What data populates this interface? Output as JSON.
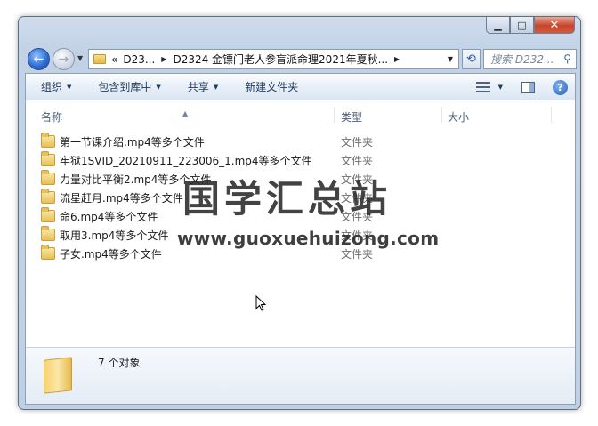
{
  "window": {
    "controls": {
      "minimize": "▁",
      "maximize": "□",
      "close": "✕"
    }
  },
  "nav": {
    "back_icon": "back-arrow-icon",
    "forward_icon": "forward-arrow-icon",
    "breadcrumb": [
      "«",
      "D23...",
      "D2324 金镖门老人参盲派命理2021年夏秋..."
    ],
    "search_placeholder": "搜索 D232..."
  },
  "toolbar": {
    "organize": "组织",
    "include_in_library": "包含到库中",
    "share": "共享",
    "new_folder": "新建文件夹"
  },
  "columns": {
    "name": "名称",
    "type": "类型",
    "size": "大小"
  },
  "files": [
    {
      "name": "第一节课介绍.mp4等多个文件",
      "type": "文件夹"
    },
    {
      "name": "牢狱1SVID_20210911_223006_1.mp4等多个文件",
      "type": "文件夹"
    },
    {
      "name": "力量对比平衡2.mp4等多个文件",
      "type": "文件夹"
    },
    {
      "name": "流星赶月.mp4等多个文件",
      "type": "文件夹"
    },
    {
      "name": "命6.mp4等多个文件",
      "type": "文件夹"
    },
    {
      "name": "取用3.mp4等多个文件",
      "type": "文件夹"
    },
    {
      "name": "子女.mp4等多个文件",
      "type": "文件夹"
    }
  ],
  "status": {
    "count": "7 个对象"
  },
  "watermark": {
    "title": "国学汇总站",
    "url": "www.guoxuehuizong.com"
  }
}
